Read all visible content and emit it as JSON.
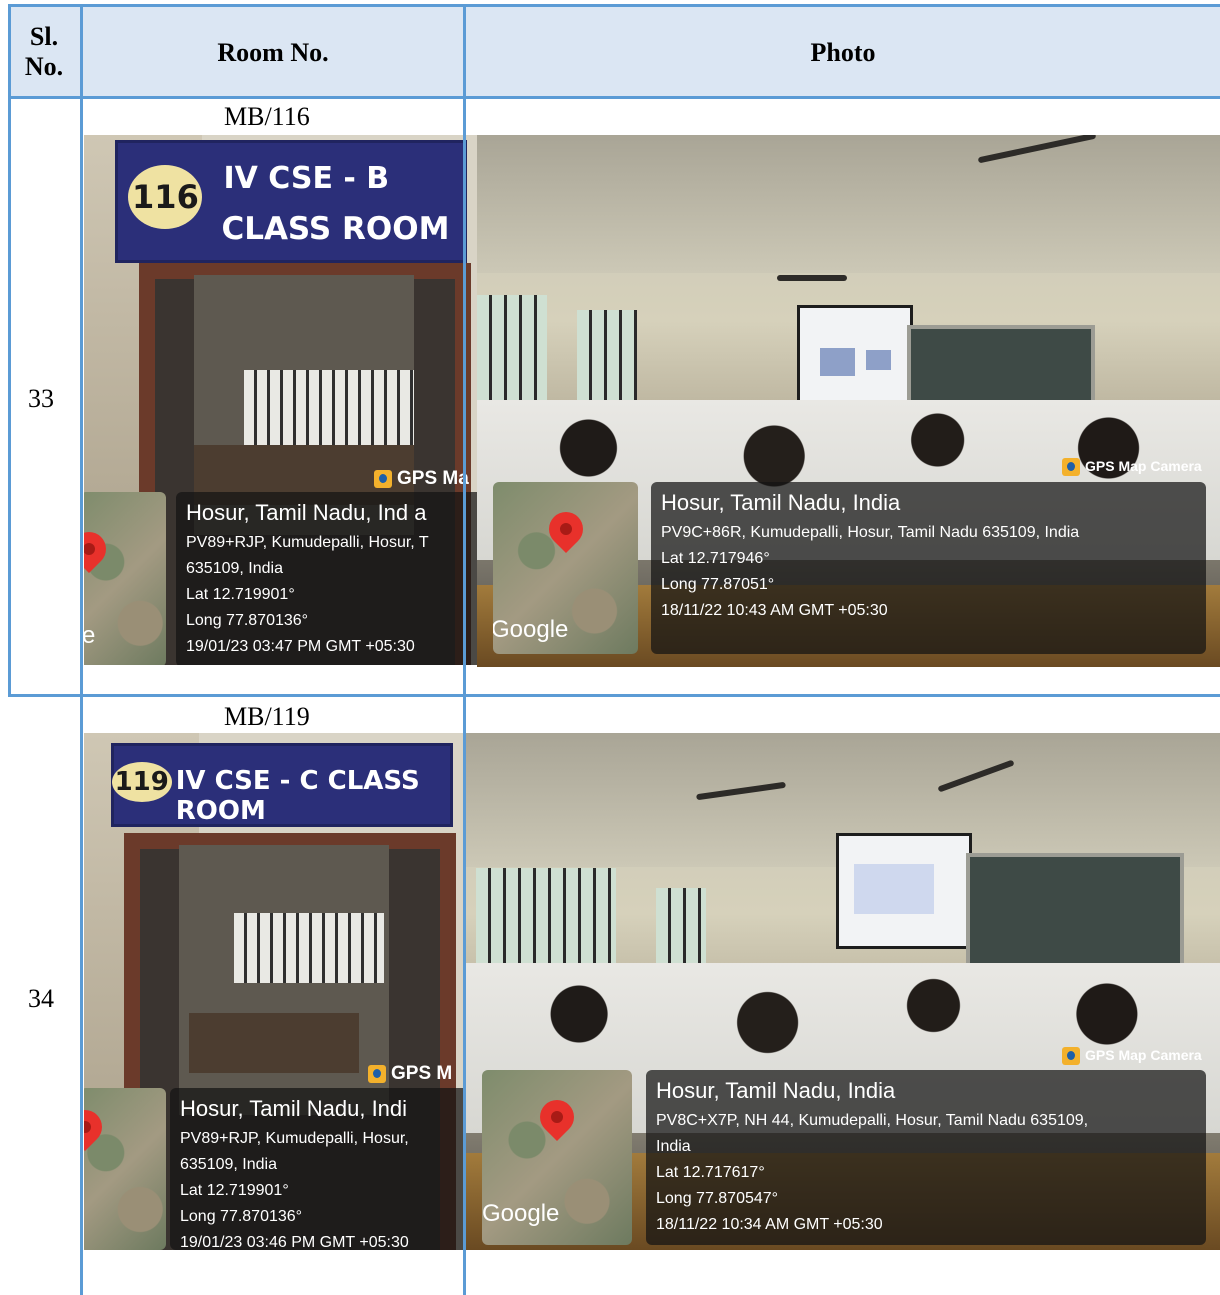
{
  "table": {
    "headers": {
      "sl_no": "Sl.\nNo.",
      "room_no": "Room No.",
      "photo": "Photo"
    },
    "rows": [
      {
        "sl_no": "33",
        "room_no": "MB/116",
        "door_photo": {
          "badge": "116",
          "board_line1": "IV CSE - B",
          "board_line2": "CLASS ROOM",
          "camera_tag": "GPS Ma",
          "gps_title": "Hosur, Tamil Nadu, Ind a",
          "gps_lines": [
            "PV89+RJP, Kumudepalli, Hosur, T",
            "635109, India",
            "Lat 12.719901°",
            "Long 77.870136°",
            "19/01/23 03:47 PM GMT +05:30"
          ],
          "map_text": "e"
        },
        "class_photo": {
          "camera_tag": "GPS Map Camera",
          "gps_title": "Hosur, Tamil Nadu, India",
          "gps_lines": [
            "PV9C+86R, Kumudepalli, Hosur, Tamil Nadu 635109, India",
            "Lat 12.717946°",
            "Long 77.87051°",
            "18/11/22 10:43 AM GMT +05:30"
          ],
          "map_text": "Google"
        }
      },
      {
        "sl_no": "34",
        "room_no": "MB/119",
        "door_photo": {
          "badge": "119",
          "board_line1": "IV CSE - C CLASS ROOM",
          "board_line2": "",
          "camera_tag": "GPS M",
          "gps_title": "Hosur, Tamil Nadu, Indi",
          "gps_lines": [
            "PV89+RJP, Kumudepalli, Hosur,",
            "635109, India",
            "Lat 12.719901°",
            "Long 77.870136°",
            "19/01/23 03:46 PM GMT +05:30"
          ],
          "map_text": ""
        },
        "class_photo": {
          "camera_tag": "GPS Map Camera",
          "gps_title": "Hosur, Tamil Nadu, India",
          "gps_lines": [
            "PV8C+X7P, NH 44, Kumudepalli, Hosur, Tamil Nadu 635109,",
            "India",
            "Lat 12.717617°",
            "Long 77.870547°",
            "18/11/22 10:34 AM GMT +05:30"
          ],
          "map_text": "Google"
        }
      }
    ]
  }
}
